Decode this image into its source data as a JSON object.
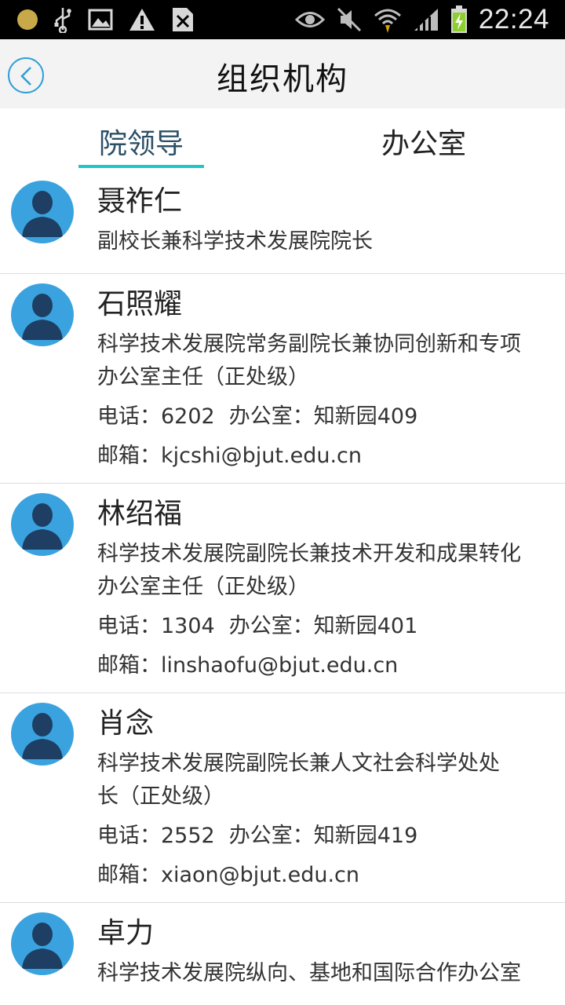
{
  "status_bar": {
    "time": "22:24",
    "icons": [
      "notification-dot-icon",
      "usb-icon",
      "image-icon",
      "warning-icon",
      "sim-icon",
      "eye-icon",
      "mute-icon",
      "wifi-icon",
      "signal-icon",
      "battery-charging-icon"
    ],
    "colors": {
      "background": "#000000",
      "text": "#e8e8e8"
    }
  },
  "header": {
    "title": "组织机构",
    "back_icon": "chevron-left-icon",
    "accent_color": "#2f9fd8"
  },
  "tabs": {
    "items": [
      {
        "label": "院领导",
        "active": true
      },
      {
        "label": "办公室",
        "active": false
      }
    ],
    "indicator_color": "#20c6c6"
  },
  "people": [
    {
      "name": "聂祚仁",
      "title_lines": [
        "副校长兼科学技术发展院院长"
      ]
    },
    {
      "name": "石照耀",
      "title_lines": [
        "科学技术发展院常务副院长兼协同创新和专项",
        "办公室主任（正处级）"
      ],
      "phone": "电话：6202",
      "office": "办公室：知新园409",
      "email": "邮箱：kjcshi@bjut.edu.cn"
    },
    {
      "name": "林绍福",
      "title_lines": [
        "科学技术发展院副院长兼技术开发和成果转化",
        "办公室主任（正处级）"
      ],
      "phone": "电话：1304",
      "office": "办公室：知新园401",
      "email": "邮箱：linshaofu@bjut.edu.cn"
    },
    {
      "name": "肖念",
      "title_lines": [
        "科学技术发展院副院长兼人文社会科学处处",
        "长（正处级）"
      ],
      "phone": "电话：2552",
      "office": "办公室：知新园419",
      "email": "邮箱：xiaon@bjut.edu.cn"
    },
    {
      "name": "卓力",
      "title_lines": [
        "科学技术发展院纵向、基地和国际合作办公室"
      ]
    }
  ]
}
